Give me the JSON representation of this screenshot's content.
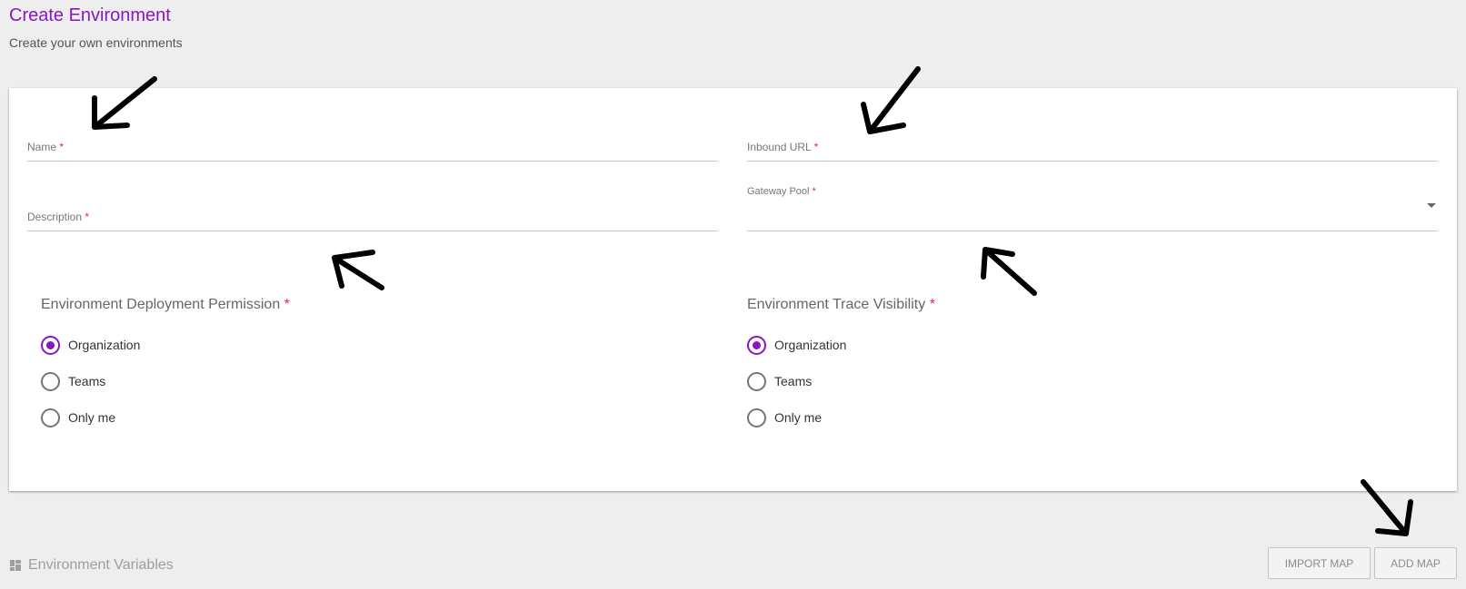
{
  "header": {
    "title": "Create Environment",
    "subtitle": "Create your own environments"
  },
  "form": {
    "name": {
      "label": "Name",
      "value": ""
    },
    "inbound_url": {
      "label": "Inbound URL",
      "value": ""
    },
    "description": {
      "label": "Description",
      "value": ""
    },
    "gateway_pool": {
      "label": "Gateway Pool",
      "selected": ""
    },
    "required_mark": "*"
  },
  "deployment_permission": {
    "title": "Environment Deployment Permission",
    "options": [
      {
        "label": "Organization",
        "checked": true
      },
      {
        "label": "Teams",
        "checked": false
      },
      {
        "label": "Only me",
        "checked": false
      }
    ]
  },
  "trace_visibility": {
    "title": "Environment Trace Visibility",
    "options": [
      {
        "label": "Organization",
        "checked": true
      },
      {
        "label": "Teams",
        "checked": false
      },
      {
        "label": "Only me",
        "checked": false
      }
    ]
  },
  "footer": {
    "section_title": "Environment Variables",
    "icon": "grid-icon",
    "import_button": "IMPORT MAP",
    "add_button": "ADD MAP"
  },
  "colors": {
    "accent": "#8a16c1",
    "required": "#e91e63",
    "background": "#eeeeee",
    "annotation_arrows": "#000000"
  }
}
